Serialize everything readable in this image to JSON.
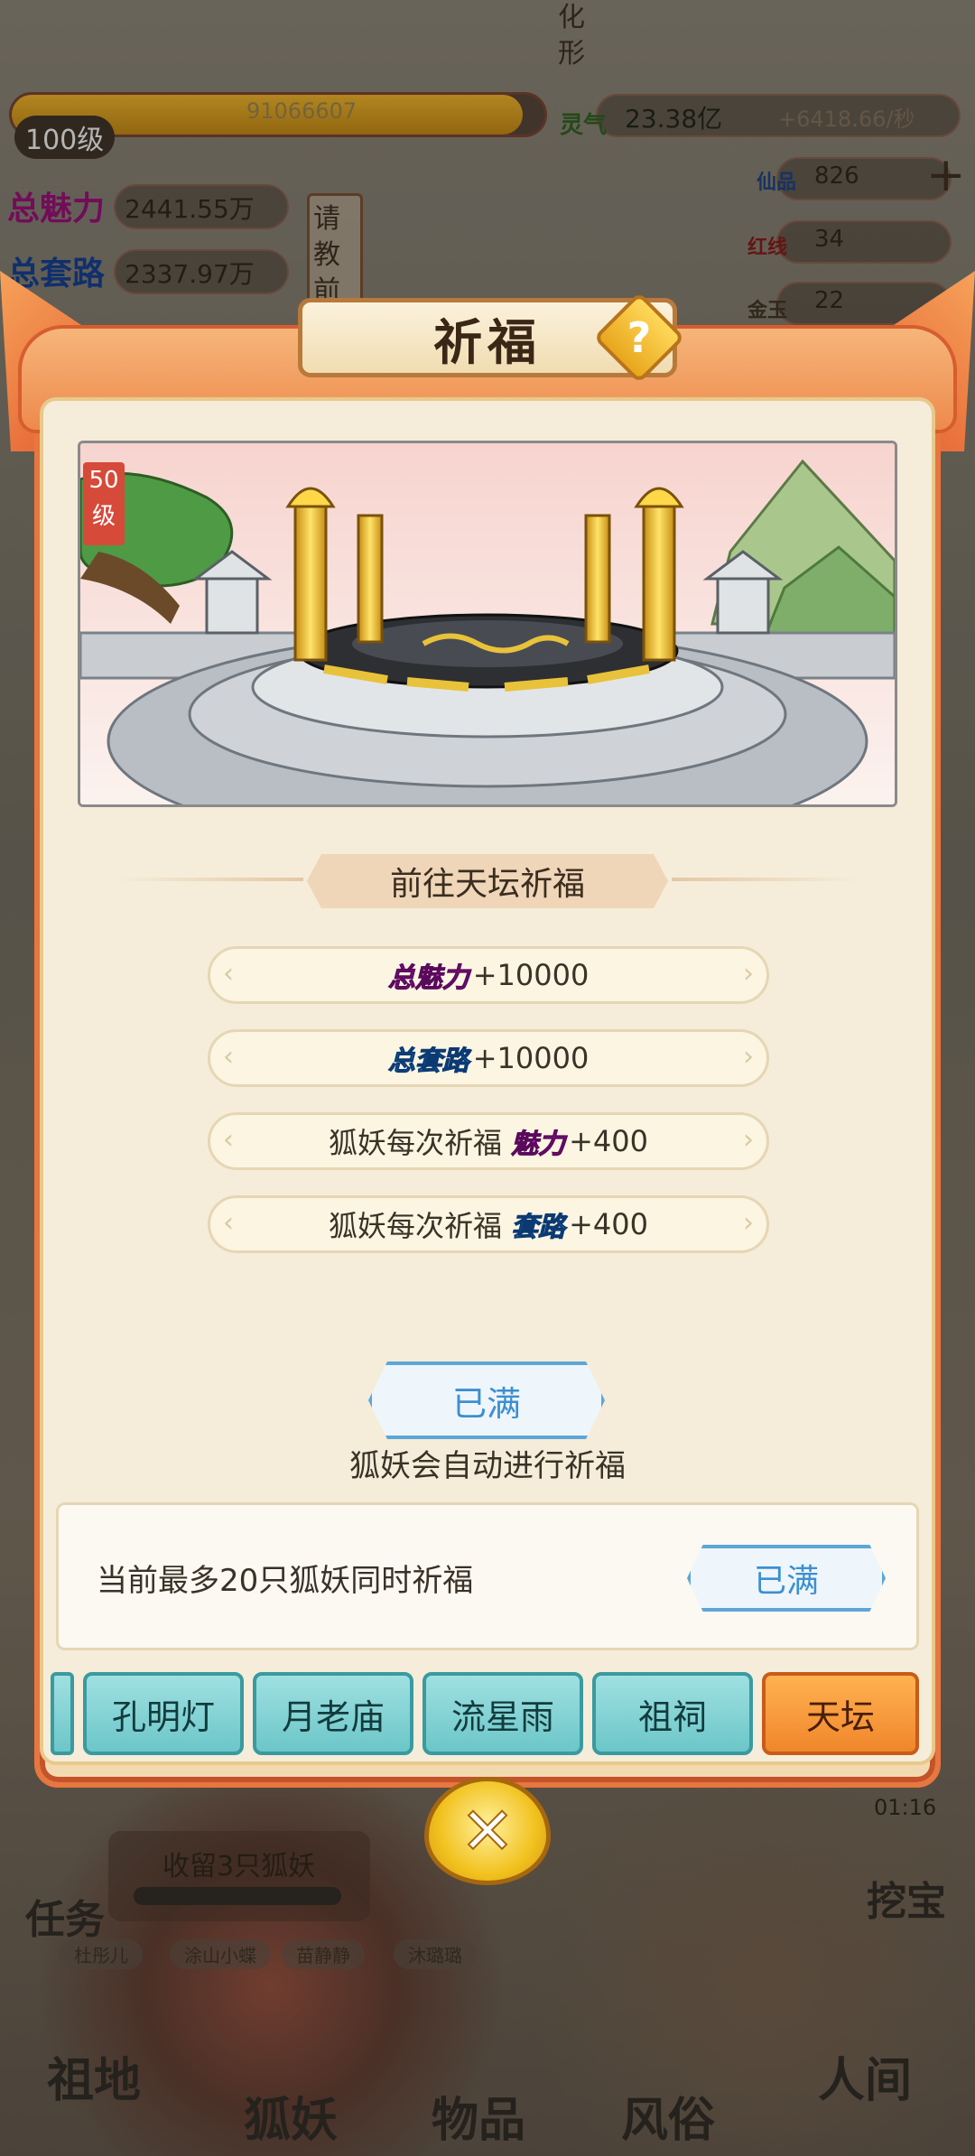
{
  "hud": {
    "level": "100级",
    "exp": "91066607",
    "spirit_label": "灵气",
    "spirit_value": "23.38亿",
    "spirit_rate": "+6418.66/秒",
    "charm_label": "总魅力",
    "charm_value": "2441.55万",
    "route_label": "总套路",
    "route_value": "2337.97万",
    "fairy_fruit_label": "仙品",
    "fairy_fruit_value": "826",
    "red_label": "红线",
    "red_value": "34",
    "gold_label": "金玉",
    "gold_value": "22",
    "advice": "请教前",
    "transform": "化形",
    "timer": "01:16",
    "task_label": "任务",
    "treasure_label": "挖宝",
    "shelter_text": "收留3只狐妖",
    "names": [
      "杜彤儿",
      "涂山小蝶",
      "苗静静",
      "沐璐璐"
    ],
    "nav": [
      "祖地",
      "狐妖",
      "物品",
      "风俗",
      "人间"
    ]
  },
  "dialog": {
    "title": "祈福",
    "help_icon": "?",
    "scene_level_top": "50",
    "scene_level_bottom": "级",
    "section_title": "前往天坛祈福",
    "bonuses": [
      {
        "tag": "总魅力",
        "tag_color": "#c21bc9",
        "prefix": "",
        "value": "+10000"
      },
      {
        "tag": "总套路",
        "tag_color": "#1f7fe0",
        "prefix": "",
        "value": "+10000"
      },
      {
        "tag": "魅力",
        "tag_color": "#c21bc9",
        "prefix": "狐妖每次祈福",
        "value": "+400"
      },
      {
        "tag": "套路",
        "tag_color": "#1f7fe0",
        "prefix": "狐妖每次祈福",
        "value": "+400"
      }
    ],
    "full_button": "已满",
    "auto_text": "狐妖会自动进行祈福",
    "limit_text": "当前最多20只狐妖同时祈福",
    "limit_button": "已满",
    "tabs": [
      {
        "label": "孔明灯",
        "active": false
      },
      {
        "label": "月老庙",
        "active": false
      },
      {
        "label": "流星雨",
        "active": false
      },
      {
        "label": "祖祠",
        "active": false
      },
      {
        "label": "天坛",
        "active": true
      }
    ]
  },
  "colors": {
    "panel_border": "#e8763f",
    "tab_active": "#f0862c",
    "tab_inactive": "#6cc6c8",
    "full_button_blue": "#3c8fd0"
  }
}
